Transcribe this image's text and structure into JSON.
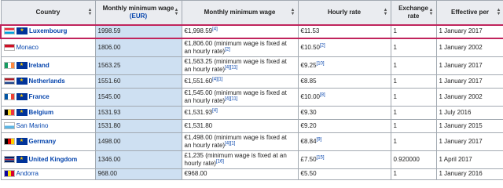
{
  "headers": {
    "country": "Country",
    "monthly_eur_line1": "Monthly minimum wage",
    "monthly_eur_line2": "(EUR)",
    "monthly": "Monthly minimum wage",
    "hourly": "Hourly rate",
    "exchange_line1": "Exchange",
    "exchange_line2": "rate",
    "effective": "Effective per"
  },
  "rows": [
    {
      "country": "Luxembourg",
      "eu": true,
      "monthly_eur": "1998.59",
      "monthly": "€1,998.59",
      "monthly_note": "[4]",
      "hourly": "€11.53",
      "hourly_note": "",
      "exchange": "1",
      "effective": "1 January 2017"
    },
    {
      "country": "Monaco",
      "eu": false,
      "monthly_eur": "1806.00",
      "monthly": "€1,806.00 (minimum wage is fixed at an hourly rate)",
      "monthly_note": "[2]",
      "hourly": "€10.50",
      "hourly_note": "[2]",
      "exchange": "1",
      "effective": "1 January 2002"
    },
    {
      "country": "Ireland",
      "eu": true,
      "monthly_eur": "1563.25",
      "monthly": "€1,563.25 (minimum wage is fixed at an hourly rate)",
      "monthly_note": "[4][11]",
      "hourly": "€9.25",
      "hourly_note": "[10]",
      "exchange": "1",
      "effective": "1 January 2017"
    },
    {
      "country": "Netherlands",
      "eu": true,
      "monthly_eur": "1551.60",
      "monthly": "€1,551.60",
      "monthly_note": "[4][1]",
      "hourly": "€8.85",
      "hourly_note": "",
      "exchange": "1",
      "effective": "1 January 2017"
    },
    {
      "country": "France",
      "eu": true,
      "monthly_eur": "1545.00",
      "monthly": "€1,545.00 (minimum wage is fixed at an hourly rate)",
      "monthly_note": "[4][11]",
      "hourly": "€10.00",
      "hourly_note": "[8]",
      "exchange": "1",
      "effective": "1 January 2002"
    },
    {
      "country": "Belgium",
      "eu": true,
      "monthly_eur": "1531.93",
      "monthly": "€1,531.93",
      "monthly_note": "[4]",
      "hourly": "€9.30",
      "hourly_note": "",
      "exchange": "1",
      "effective": "1 July 2016"
    },
    {
      "country": "San Marino",
      "eu": false,
      "monthly_eur": "1531.80",
      "monthly": "€1,531.80",
      "monthly_note": "",
      "hourly": "€9.20",
      "hourly_note": "",
      "exchange": "1",
      "effective": "1 January 2015"
    },
    {
      "country": "Germany",
      "eu": true,
      "monthly_eur": "1498.00",
      "monthly": "€1,498.00 (minimum wage is fixed at an hourly rate)",
      "monthly_note": "[4][1]",
      "hourly": "€8.84",
      "hourly_note": "[9]",
      "exchange": "1",
      "effective": "1 January 2017"
    },
    {
      "country": "United Kingdom",
      "eu": true,
      "monthly_eur": "1346.00",
      "monthly": "£1,235 (minimum wage is fixed at an hourly rate)",
      "monthly_note": "[16]",
      "hourly": "£7.50",
      "hourly_note": "[15]",
      "exchange": "0.920000",
      "effective": "1 April 2017"
    },
    {
      "country": "Andorra",
      "eu": false,
      "monthly_eur": "968.00",
      "monthly": "€968.00",
      "monthly_note": "",
      "hourly": "€5.50",
      "hourly_note": "",
      "exchange": "1",
      "effective": "1 January 2016"
    }
  ],
  "flags": {
    "Luxembourg": [
      "#ed2939",
      "#ffffff",
      "#00a1de"
    ],
    "Monaco": [
      "#ce1126",
      "#ffffff"
    ],
    "Ireland": [
      "#169b62",
      "#ffffff",
      "#ff883e"
    ],
    "Netherlands": [
      "#ae1c28",
      "#ffffff",
      "#21468b"
    ],
    "France": [
      "#0055a4",
      "#ffffff",
      "#ef4135"
    ],
    "Belgium": [
      "#000000",
      "#fdda24",
      "#ef3340"
    ],
    "San Marino": [
      "#ffffff",
      "#5eb6e4"
    ],
    "Germany": [
      "#000000",
      "#dd0000",
      "#ffce00"
    ],
    "United Kingdom": [
      "#012169",
      "#c8102e",
      "#ffffff"
    ],
    "Andorra": [
      "#10069f",
      "#fedf00",
      "#d50032"
    ]
  },
  "eu_icon": "eu-flag-icon",
  "sort_icon": "sort-arrows-icon",
  "highlight_color": "#c0245c"
}
